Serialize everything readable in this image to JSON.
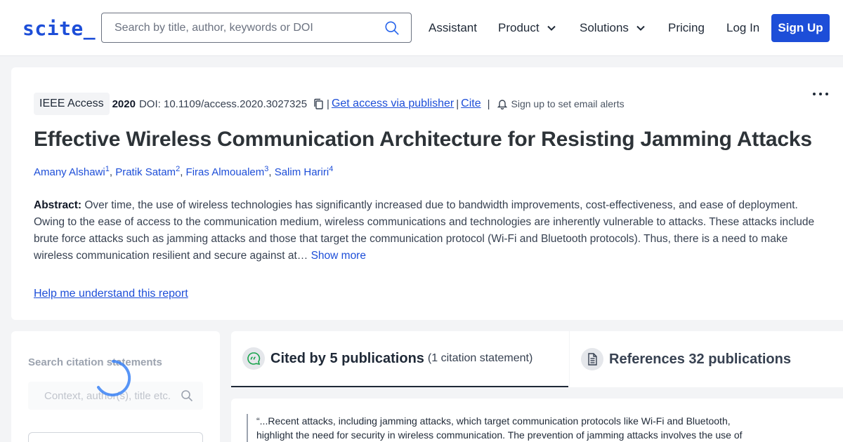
{
  "header": {
    "logo": "scite_",
    "search_placeholder": "Search by title, author, keywords or DOI",
    "nav": {
      "assistant": "Assistant",
      "product": "Product",
      "solutions": "Solutions",
      "pricing": "Pricing",
      "login": "Log In",
      "signup": "Sign Up"
    }
  },
  "paper": {
    "journal": "IEEE Access",
    "year": "2020",
    "doi": "DOI: 10.1109/access.2020.3027325",
    "sep": "|",
    "get_access": "Get access via publisher",
    "cite": "Cite",
    "alerts": "Sign up to set email alerts",
    "title": "Effective Wireless Communication Architecture for Resisting Jamming Attacks",
    "authors": [
      {
        "name": "Amany Alshawi",
        "sup": "1"
      },
      {
        "name": "Pratik Satam",
        "sup": "2"
      },
      {
        "name": "Firas Almoualem",
        "sup": "3"
      },
      {
        "name": "Salim Hariri",
        "sup": "4"
      }
    ],
    "comma": ",",
    "abstract_label": "Abstract:",
    "abstract_text": " Over time, the use of wireless technologies has significantly increased due to bandwidth improvements, cost-effectiveness, and ease of deployment. Owing to the ease of access to the communication medium, wireless communications and technologies are inherently vulnerable to attacks. These attacks include brute force attacks such as jamming attacks and those that target the communication protocol (Wi-Fi and Bluetooth protocols). Thus, there is a need to make wireless communication resilient and secure against at…",
    "show_more": " Show more",
    "help": "Help me understand this report"
  },
  "left_panel": {
    "label": "Search citation statements",
    "placeholder": "Context, author(s), title etc."
  },
  "tabs": {
    "cited_strong": "Cited by 5 publications",
    "cited_sub": "(1 citation statement)",
    "refs_strong": "References 32 publications"
  },
  "snippet": {
    "text": "“...Recent attacks, including jamming attacks, which target communication protocols like Wi-Fi and Bluetooth, highlight the need for security in wireless communication. The prevention of jamming attacks involves the use of"
  },
  "colors": {
    "brand": "#1d4ed8",
    "page_bg": "#f3f4f6"
  }
}
